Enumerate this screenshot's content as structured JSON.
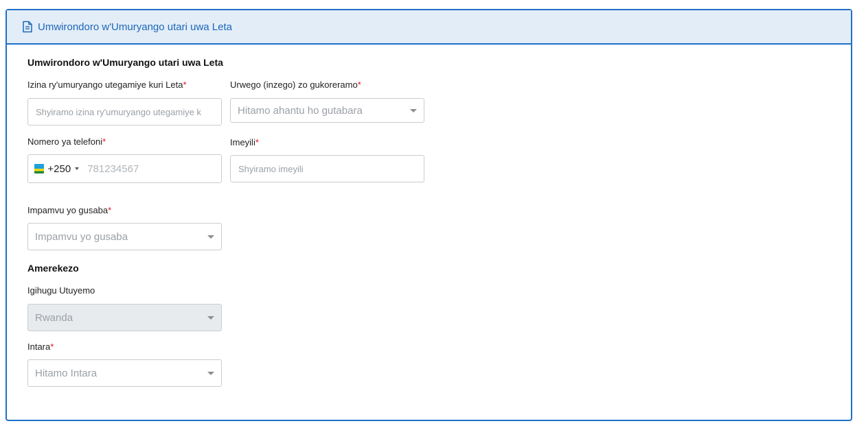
{
  "header": {
    "title": "Umwirondoro w'Umuryango utari uwa Leta"
  },
  "section": {
    "title": "Umwirondoro w'Umuryango utari uwa Leta"
  },
  "org_name": {
    "label": "Izina ry'umuryango utegamiye kuri Leta",
    "required": "*",
    "placeholder": "Shyiramo izina ry'umuryango utegamiye k"
  },
  "work_level": {
    "label": "Urwego (inzego) zo gukoreramo",
    "required": "*",
    "placeholder": "Hitamo ahantu ho gutabara"
  },
  "phone": {
    "label": "Nomero ya telefoni",
    "required": "*",
    "dial_code": "+250",
    "placeholder": "781234567"
  },
  "email": {
    "label": "Imeyili",
    "required": "*",
    "placeholder": "Shyiramo imeyili"
  },
  "reason": {
    "label": "Impamvu yo gusaba",
    "required": "*",
    "placeholder": "Impamvu yo gusaba"
  },
  "address": {
    "title": "Amerekezo"
  },
  "country": {
    "label": "Igihugu Utuyemo",
    "value": "Rwanda"
  },
  "province": {
    "label": "Intara",
    "required": "*",
    "placeholder": "Hitamo Intara"
  },
  "colors": {
    "accent": "#1f6fc5",
    "header_bg": "#e3edf8",
    "required": "#e0102a"
  }
}
